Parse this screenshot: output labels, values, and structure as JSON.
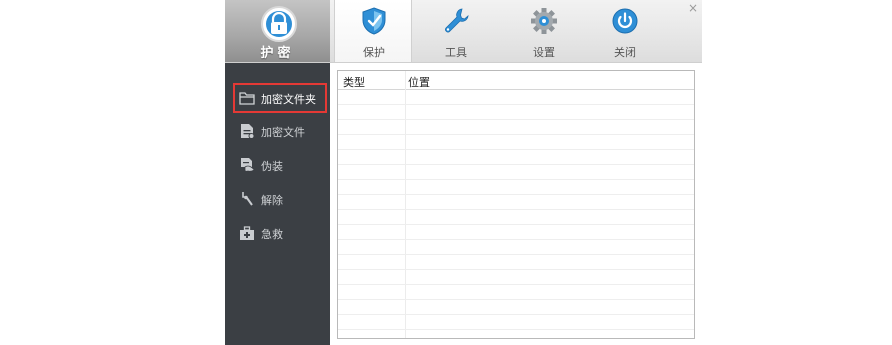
{
  "logo": {
    "brand": "护密",
    "icon": "padlock-shield-icon"
  },
  "nav": {
    "tabs": [
      {
        "label": "保护",
        "icon": "shield-icon",
        "active": true
      },
      {
        "label": "工具",
        "icon": "wrench-icon",
        "active": false
      },
      {
        "label": "设置",
        "icon": "gear-icon",
        "active": false
      },
      {
        "label": "关闭",
        "icon": "power-icon",
        "active": false
      }
    ],
    "close_glyph": "×"
  },
  "sidebar": {
    "items": [
      {
        "label": "加密文件夹",
        "icon": "folder-icon",
        "selected": true
      },
      {
        "label": "加密文件",
        "icon": "file-icon",
        "selected": false
      },
      {
        "label": "伪装",
        "icon": "disguise-icon",
        "selected": false
      },
      {
        "label": "解除",
        "icon": "unlock-icon",
        "selected": false
      },
      {
        "label": "急救",
        "icon": "first-aid-kit-icon",
        "selected": false
      }
    ]
  },
  "table": {
    "columns": [
      "类型",
      "位置"
    ],
    "rows": []
  },
  "colors": {
    "sidebar_bg": "#3b3f44",
    "selection_outline": "#e53935",
    "accent_blue": "#2f8fd6"
  }
}
